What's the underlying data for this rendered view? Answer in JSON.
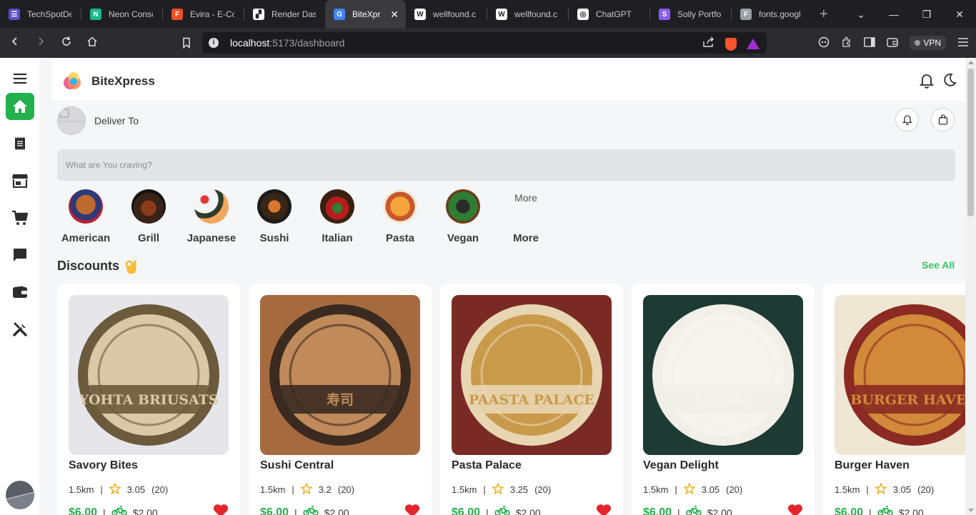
{
  "browser": {
    "tabs": [
      {
        "title": "TechSpotDe",
        "fav_color": "#5a4fcf",
        "fav_char": "☰",
        "active": false
      },
      {
        "title": "Neon Conso",
        "fav_color": "#18ba8c",
        "fav_char": "N",
        "active": false
      },
      {
        "title": "Evira - E-Co",
        "fav_color": "#f24e1e",
        "fav_char": "F",
        "active": false
      },
      {
        "title": "Render Dasl",
        "fav_color": "#ffffff",
        "fav_char": "▞",
        "active": false
      },
      {
        "title": "BiteXpr",
        "fav_color": "#4285f4",
        "fav_char": "G",
        "active": true
      },
      {
        "title": "wellfound.c",
        "fav_color": "#ffffff",
        "fav_char": "W",
        "active": false
      },
      {
        "title": "wellfound.c",
        "fav_color": "#ffffff",
        "fav_char": "W",
        "active": false
      },
      {
        "title": "ChatGPT",
        "fav_color": "#ffffff",
        "fav_char": "◎",
        "active": false
      },
      {
        "title": "Solly Portfo",
        "fav_color": "#8b5cf6",
        "fav_char": "S",
        "active": false
      },
      {
        "title": "fonts.googl",
        "fav_color": "#9aa0a6",
        "fav_char": "F",
        "active": false
      }
    ],
    "close_tab_glyph": "✕",
    "new_tab_glyph": "+",
    "url_host": "localhost",
    "url_path": ":5173/dashboard",
    "vpn_label": "VPN",
    "window_controls": [
      "⌄",
      "—",
      "❐",
      "✕"
    ]
  },
  "app": {
    "brand": "BiteXpress",
    "deliver_to": "Deliver To",
    "search_placeholder": "What are You craving?",
    "accent_color": "#22b14c",
    "categories": [
      {
        "label": "American",
        "img_kind": "american"
      },
      {
        "label": "Grill",
        "img_kind": "grill"
      },
      {
        "label": "Japanese",
        "img_kind": "japanese"
      },
      {
        "label": "Sushi",
        "img_kind": "sushi"
      },
      {
        "label": "Italian",
        "img_kind": "italian"
      },
      {
        "label": "Pasta",
        "img_kind": "pasta"
      },
      {
        "label": "Vegan",
        "img_kind": "vegan"
      },
      {
        "label": "More",
        "img_kind": "broken",
        "alt": "More"
      }
    ],
    "discounts": {
      "title": "Discounts",
      "see_all": "See All",
      "cards": [
        {
          "name": "Savory Bites",
          "distance": "1.5km",
          "rating": "3.05",
          "reviews": "(20)",
          "price": "$6.00",
          "delivery_fee": "$2.00",
          "logo_text": "YOHTA BRIUSATS",
          "bg": "#e6e6ea",
          "ring": "#6b5a3c",
          "inner": "#d9c9a7"
        },
        {
          "name": "Sushi Central",
          "distance": "1.5km",
          "rating": "3.2",
          "reviews": "(20)",
          "price": "$6.00",
          "delivery_fee": "$2.00",
          "logo_text": "寿司",
          "bg": "#a56b3f",
          "ring": "#3a2a20",
          "inner": "#c08a5a"
        },
        {
          "name": "Pasta Palace",
          "distance": "1.5km",
          "rating": "3.25",
          "reviews": "(20)",
          "price": "$6.00",
          "delivery_fee": "$2.00",
          "logo_text": "PAASTA PALACE",
          "bg": "#7a2a25",
          "ring": "#e8d6b3",
          "inner": "#c99a4a"
        },
        {
          "name": "Vegan Delight",
          "distance": "1.5km",
          "rating": "3.05",
          "reviews": "(20)",
          "price": "$6.00",
          "delivery_fee": "$2.00",
          "logo_text": "V.egain",
          "bg": "#1d3a33",
          "ring": "#f1efe7",
          "inner": "#f6f4ec"
        },
        {
          "name": "Burger Haven",
          "distance": "1.5km",
          "rating": "3.05",
          "reviews": "(20)",
          "price": "$6.00",
          "delivery_fee": "$2.00",
          "logo_text": "BURGER HAVEN",
          "bg": "#efe6d4",
          "ring": "#8a2a22",
          "inner": "#d08a3a"
        }
      ]
    }
  }
}
